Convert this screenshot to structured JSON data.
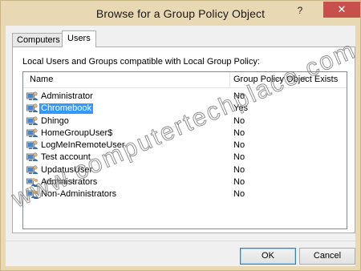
{
  "window": {
    "title": "Browse for a Group Policy Object",
    "help_label": "?",
    "close_label": "✕"
  },
  "tabs": [
    {
      "label": "Computers",
      "active": false
    },
    {
      "label": "Users",
      "active": true
    }
  ],
  "panel": {
    "caption": "Local Users and Groups compatible with Local Group Policy:",
    "columns": {
      "name": "Name",
      "gpo": "Group Policy Object Exists"
    },
    "rows": [
      {
        "name": "Administrator",
        "gpo": "No",
        "icon": "user-icon",
        "selected": false
      },
      {
        "name": "Chromebook",
        "gpo": "Yes",
        "icon": "user-icon",
        "selected": true
      },
      {
        "name": "Dhingo",
        "gpo": "No",
        "icon": "user-icon",
        "selected": false
      },
      {
        "name": "HomeGroupUser$",
        "gpo": "No",
        "icon": "user-icon",
        "selected": false
      },
      {
        "name": "LogMeInRemoteUser",
        "gpo": "No",
        "icon": "user-icon",
        "selected": false
      },
      {
        "name": "Test account",
        "gpo": "No",
        "icon": "user-icon",
        "selected": false
      },
      {
        "name": "UpdatusUser",
        "gpo": "No",
        "icon": "user-icon",
        "selected": false
      },
      {
        "name": "Administrators",
        "gpo": "No",
        "icon": "group-icon",
        "selected": false
      },
      {
        "name": "Non-Administrators",
        "gpo": "No",
        "icon": "group-icon",
        "selected": false
      }
    ]
  },
  "buttons": {
    "ok": "OK",
    "cancel": "Cancel"
  },
  "watermark": {
    "text": "www.computertechplace.com"
  },
  "colors": {
    "titlebar": "#e9d8b4",
    "close": "#c7504d",
    "selection": "#3399ff"
  }
}
